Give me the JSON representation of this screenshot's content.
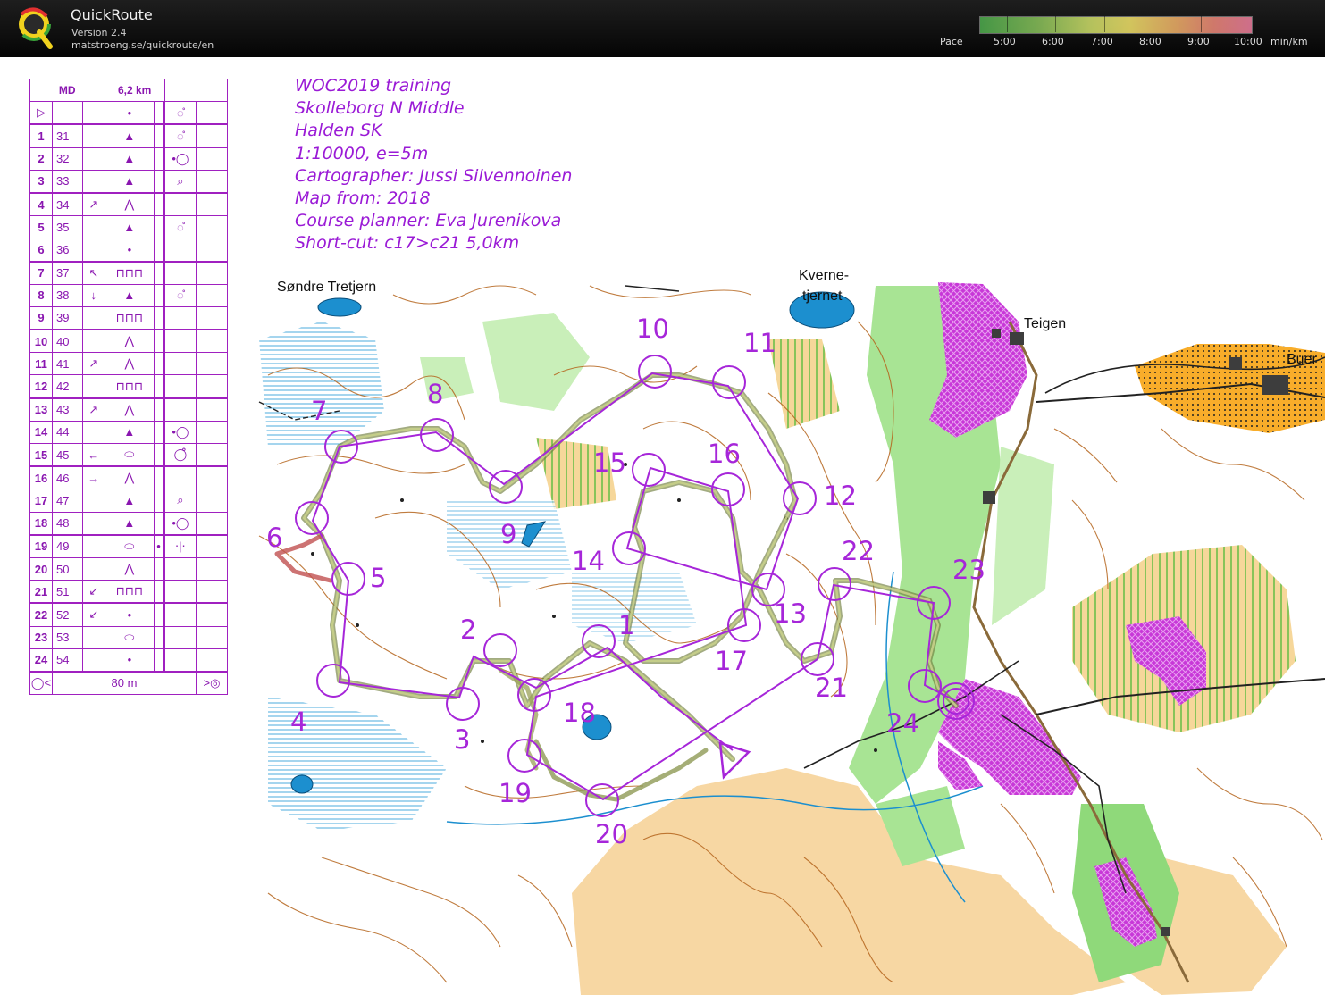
{
  "app": {
    "name": "QuickRoute",
    "version": "Version 2.4",
    "url": "matstroeng.se/quickroute/en"
  },
  "pace_scale": {
    "label": "Pace",
    "ticks": [
      "5:00",
      "6:00",
      "7:00",
      "8:00",
      "9:00",
      "10:00"
    ],
    "unit": "min/km"
  },
  "course_info": [
    "WOC2019 training",
    "Skolleborg N Middle",
    "Halden SK",
    "1:10000, e=5m",
    "Cartographer: Jussi Silvennoinen",
    "Map from: 2018",
    "Course planner: Eva Jurenikova",
    "Short-cut: c17>c21 5,0km"
  ],
  "description": {
    "class": "MD",
    "length": "6,2 km",
    "finish_distance": "80 m",
    "start_symbol": "▷",
    "rows": [
      {
        "n": "1",
        "code": "31",
        "dir": "",
        "feat": "▲",
        "extra": "",
        "misc": "◌̊"
      },
      {
        "n": "2",
        "code": "32",
        "dir": "",
        "feat": "▲",
        "extra": "",
        "misc": "•◯"
      },
      {
        "n": "3",
        "code": "33",
        "dir": "",
        "feat": "▲",
        "extra": "",
        "misc": "⌕"
      },
      {
        "n": "4",
        "code": "34",
        "dir": "↗",
        "feat": "⋀",
        "extra": "",
        "misc": ""
      },
      {
        "n": "5",
        "code": "35",
        "dir": "",
        "feat": "▲",
        "extra": "",
        "misc": "◌̊"
      },
      {
        "n": "6",
        "code": "36",
        "dir": "",
        "feat": "•",
        "extra": "",
        "misc": ""
      },
      {
        "n": "7",
        "code": "37",
        "dir": "↖",
        "feat": "⊓⊓⊓",
        "extra": "",
        "misc": ""
      },
      {
        "n": "8",
        "code": "38",
        "dir": "↓",
        "feat": "▲",
        "extra": "",
        "misc": "◌̊"
      },
      {
        "n": "9",
        "code": "39",
        "dir": "",
        "feat": "⊓⊓⊓",
        "extra": "",
        "misc": ""
      },
      {
        "n": "10",
        "code": "40",
        "dir": "",
        "feat": "⋀",
        "extra": "",
        "misc": ""
      },
      {
        "n": "11",
        "code": "41",
        "dir": "↗",
        "feat": "⋀",
        "extra": "",
        "misc": ""
      },
      {
        "n": "12",
        "code": "42",
        "dir": "",
        "feat": "⊓⊓⊓",
        "extra": "",
        "misc": ""
      },
      {
        "n": "13",
        "code": "43",
        "dir": "↗",
        "feat": "⋀",
        "extra": "",
        "misc": ""
      },
      {
        "n": "14",
        "code": "44",
        "dir": "",
        "feat": "▲",
        "extra": "",
        "misc": "•◯"
      },
      {
        "n": "15",
        "code": "45",
        "dir": "←",
        "feat": "⬭",
        "extra": "",
        "misc": "◯̊"
      },
      {
        "n": "16",
        "code": "46",
        "dir": "→",
        "feat": "⋀",
        "extra": "",
        "misc": ""
      },
      {
        "n": "17",
        "code": "47",
        "dir": "",
        "feat": "▲",
        "extra": "",
        "misc": "⌕"
      },
      {
        "n": "18",
        "code": "48",
        "dir": "",
        "feat": "▲",
        "extra": "",
        "misc": "•◯"
      },
      {
        "n": "19",
        "code": "49",
        "dir": "",
        "feat": "⬭",
        "extra": "•",
        "misc": "⋅|⋅"
      },
      {
        "n": "20",
        "code": "50",
        "dir": "",
        "feat": "⋀",
        "extra": "",
        "misc": ""
      },
      {
        "n": "21",
        "code": "51",
        "dir": "↙",
        "feat": "⊓⊓⊓",
        "extra": "",
        "misc": ""
      },
      {
        "n": "22",
        "code": "52",
        "dir": "↙",
        "feat": "•",
        "extra": "",
        "misc": ""
      },
      {
        "n": "23",
        "code": "53",
        "dir": "",
        "feat": "⬭",
        "extra": "",
        "misc": ""
      },
      {
        "n": "24",
        "code": "54",
        "dir": "",
        "feat": "•",
        "extra": "",
        "misc": ""
      }
    ]
  },
  "place_names": [
    "Søndre Tretjern",
    "Kverne-",
    "tjernet",
    "Teigen",
    "Buer"
  ],
  "control_labels": [
    "1",
    "2",
    "3",
    "4",
    "5",
    "6",
    "7",
    "8",
    "9",
    "10",
    "11",
    "12",
    "13",
    "14",
    "15",
    "16",
    "17",
    "18",
    "19",
    "20",
    "21",
    "22",
    "23",
    "24"
  ],
  "colors": {
    "course": "#a626d9",
    "contour": "#b5651d",
    "open_land": "#f5c98a",
    "forest_green": "#9be08a",
    "marsh_blue": "#3aa0d8",
    "water": "#1c8fcf",
    "private_area": "#b41ec8"
  }
}
